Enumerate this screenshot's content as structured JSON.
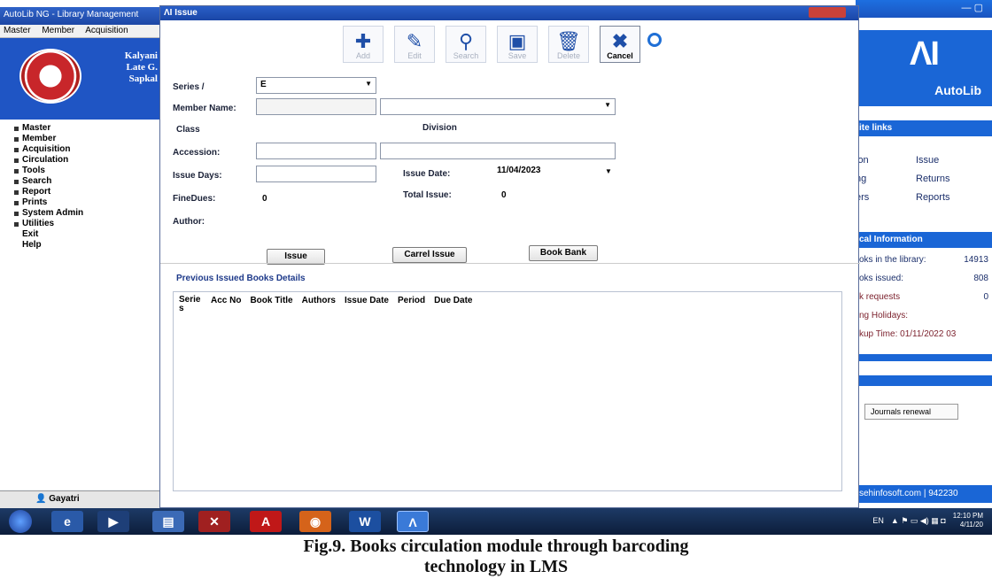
{
  "main_window": {
    "title": "AutoLib NG - Library Management",
    "menu": [
      "Master",
      "Member",
      "Acquisition"
    ],
    "org_lines": [
      "Kalyani",
      "Late G.",
      "Sapkal"
    ],
    "nav": [
      "Master",
      "Member",
      "Acquisition",
      "Circulation",
      "Tools",
      "Search",
      "Report",
      "Prints",
      "System Admin",
      "Utilities",
      "Exit",
      "Help"
    ],
    "user": "Gayatri"
  },
  "issue_dialog": {
    "title": "Issue",
    "toolbar": [
      {
        "label": "Add",
        "icon": "add-icon",
        "glyph": "✚",
        "active": false
      },
      {
        "label": "Edit",
        "icon": "edit-icon",
        "glyph": "✎",
        "active": false
      },
      {
        "label": "Search",
        "icon": "search-icon",
        "glyph": "⚲",
        "active": false
      },
      {
        "label": "Save",
        "icon": "save-icon",
        "glyph": "▣",
        "active": false
      },
      {
        "label": "Delete",
        "icon": "delete-icon",
        "glyph": "🗑",
        "active": false
      },
      {
        "label": "Cancel",
        "icon": "cancel-icon",
        "glyph": "✖",
        "active": true
      }
    ],
    "fields": {
      "series_label": "Series /",
      "series_value": "E",
      "member_name_label": "Member Name:",
      "class_label": "Class",
      "division_label": "Division",
      "accession_label": "Accession:",
      "issue_days_label": "Issue Days:",
      "issue_date_label": "Issue Date:",
      "issue_date_value": "11/04/2023",
      "fine_dues_label": "FineDues:",
      "fine_dues_value": "0",
      "total_issue_label": "Total Issue:",
      "total_issue_value": "0",
      "author_label": "Author:"
    },
    "buttons": {
      "issue": "Issue",
      "carrel_issue": "Carrel Issue",
      "book_bank": "Book Bank"
    },
    "previous_title": "Previous Issued Books Details",
    "grid_columns": [
      "Serie s",
      "Acc No",
      "Book Title",
      "Authors",
      "Issue Date",
      "Period",
      "Due Date"
    ]
  },
  "right_panel": {
    "brand": "AutoLib",
    "quick_links_title": "ite links",
    "quick_links": [
      [
        "ion",
        "Issue"
      ],
      [
        "ng",
        "Returns"
      ],
      [
        "ers",
        "Reports"
      ]
    ],
    "info_title": "cal Information",
    "info": [
      {
        "label": "oks in the library:",
        "value": "14913"
      },
      {
        "label": "oks issued:",
        "value": "808"
      },
      {
        "label": "k requests",
        "value": "0"
      },
      {
        "label": "ng Holidays:",
        "value": ""
      },
      {
        "label": "kup Time: 01/11/2022 03",
        "value": ""
      }
    ],
    "journals": "Journals renewal",
    "footer": "sehinfosoft.com | 942230"
  },
  "taskbar": {
    "lang": "EN",
    "time": "12:10 PM",
    "date": "4/11/20"
  },
  "caption": {
    "line1": "Fig.9. Books circulation module through barcoding",
    "line2": "technology in LMS"
  }
}
